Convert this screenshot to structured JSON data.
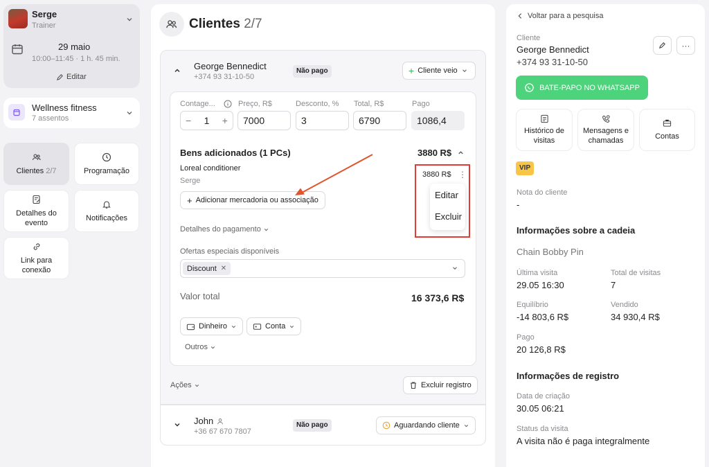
{
  "sidebar": {
    "user": {
      "name": "Serge",
      "role": "Trainer"
    },
    "event": {
      "date": "29 maio",
      "time": "10:00–11:45 · 1 h. 45 min.",
      "edit": "Editar"
    },
    "place": {
      "name": "Wellness fitness",
      "seats": "7 assentos"
    },
    "nav": {
      "clients": "Clientes",
      "clients_count": "2/7",
      "schedule": "Programação",
      "details": "Detalhes do evento",
      "notifications": "Notificações",
      "link": "Link para conexão"
    }
  },
  "main": {
    "title": "Clientes",
    "count": "2/7",
    "client1": {
      "name": "George Bennedict",
      "phone": "+374 93 31-10-50",
      "payment_badge": "Não pago",
      "status": "Cliente veio",
      "fields": {
        "count_label": "Contage...",
        "count_value": "1",
        "price_label": "Preço, R$",
        "price_value": "7000",
        "discount_label": "Desconto, %",
        "discount_value": "3",
        "total_label": "Total, R$",
        "total_value": "6790",
        "paid_label": "Pago",
        "paid_value": "1086,4"
      },
      "goods": {
        "title": "Bens adicionados (1 PCs)",
        "sum": "3880 R$",
        "item_name": "Loreal conditioner",
        "item_seller": "Serge",
        "item_price": "3880 R$",
        "add_button": "Adicionar mercadoria ou associação",
        "menu": {
          "edit": "Editar",
          "delete": "Excluir"
        }
      },
      "payment_details": "Detalhes do pagamento",
      "offers_label": "Ofertas especiais disponíveis",
      "offer_chip": "Discount",
      "total_label": "Valor total",
      "total_value": "16 373,6 R$",
      "pay_cash": "Dinheiro",
      "pay_account": "Conta",
      "others": "Outros",
      "actions": "Ações",
      "delete_record": "Excluir registro"
    },
    "client2": {
      "name": "John",
      "phone": "+36 67 670 7807",
      "payment_badge": "Não pago",
      "status": "Aguardando cliente"
    }
  },
  "panel": {
    "back": "Voltar para a pesquisa",
    "client_label": "Cliente",
    "client_name": "George Bennedict",
    "client_phone": "+374 93 31-10-50",
    "whatsapp": "BATE-PAPO NO WHATSAPP",
    "tiles": {
      "history": "Histórico de visitas",
      "messages": "Mensagens e chamadas",
      "accounts": "Contas"
    },
    "vip": "VIP",
    "note_label": "Nota do cliente",
    "note_value": "-",
    "chain_title": "Informações sobre a cadeia",
    "chain_name": "Chain Bobby Pin",
    "last_visit_label": "Última visita",
    "last_visit": "29.05 16:30",
    "total_visits_label": "Total de visitas",
    "total_visits": "7",
    "balance_label": "Equilíbrio",
    "balance": "-14 803,6 R$",
    "sold_label": "Vendido",
    "sold": "34 930,4 R$",
    "paid_label": "Pago",
    "paid": "20 126,8 R$",
    "reg_title": "Informações de registro",
    "created_label": "Data de criação",
    "created": "30.05 06:21",
    "visit_status_label": "Status da visita",
    "visit_status": "A visita não é paga integralmente"
  },
  "colors": {
    "whatsapp": "#4cd37c",
    "vip": "#f7c646",
    "highlight": "#e53935",
    "arrow": "#e0542e"
  }
}
